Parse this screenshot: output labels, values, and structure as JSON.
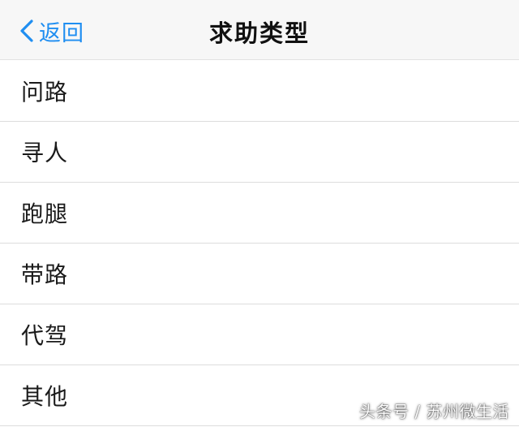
{
  "navbar": {
    "back_label": "返回",
    "title": "求助类型"
  },
  "help_types": [
    {
      "label": "问路"
    },
    {
      "label": "寻人"
    },
    {
      "label": "跑腿"
    },
    {
      "label": "带路"
    },
    {
      "label": "代驾"
    },
    {
      "label": "其他"
    }
  ],
  "watermark": "头条号 / 苏州微生活",
  "colors": {
    "accent": "#1f8ef1",
    "navbar_bg": "#f7f7f7",
    "separator": "#dddddd",
    "text": "#1a1a1a"
  },
  "icons": {
    "back": "chevron-left-icon"
  }
}
